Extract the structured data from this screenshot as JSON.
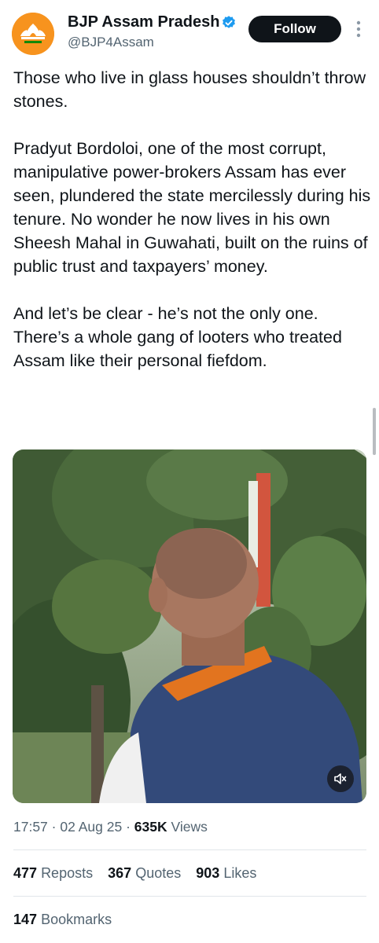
{
  "author": {
    "name": "BJP Assam Pradesh",
    "handle": "@BJP4Assam",
    "verified": true,
    "avatar_color": "#f7931e"
  },
  "follow_label": "Follow",
  "tweet": {
    "paragraphs": [
      "Those who live in glass houses shouldn’t throw stones.",
      "Pradyut Bordoloi, one of the most corrupt, manipulative power-brokers Assam has ever seen, plundered the state mercilessly during his tenure. No wonder he now lives in his own Sheesh Mahal in Guwahati, built on the ruins of public trust and taxpayers’ money.",
      "And let’s be clear - he’s not the only one. There’s a whole gang of looters who treated Assam like their personal fiefdom."
    ]
  },
  "media": {
    "type": "video",
    "volume_icon": "speaker-muted-icon"
  },
  "meta": {
    "time": "17:57",
    "date": "02 Aug 25",
    "views_count": "635K",
    "views_label": "Views"
  },
  "stats": {
    "reposts_count": "477",
    "reposts_label": "Reposts",
    "quotes_count": "367",
    "quotes_label": "Quotes",
    "likes_count": "903",
    "likes_label": "Likes",
    "bookmarks_count": "147",
    "bookmarks_label": "Bookmarks"
  },
  "colors": {
    "text": "#0f1419",
    "secondary": "#536471",
    "verified": "#1d9bf0",
    "button_bg": "#0f1419"
  }
}
